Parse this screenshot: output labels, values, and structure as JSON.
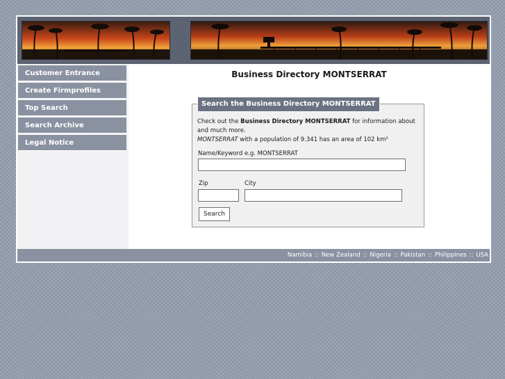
{
  "nav": {
    "items": [
      {
        "label": "Customer Entrance"
      },
      {
        "label": "Create Firmprofiles"
      },
      {
        "label": "Top Search"
      },
      {
        "label": "Search Archive"
      },
      {
        "label": "Legal Notice"
      }
    ]
  },
  "main": {
    "title": "Business Directory MONTSERRAT",
    "search_box": {
      "legend": "Search the Business Directory MONTSERRAT",
      "desc_prefix": "Check out the ",
      "desc_bold": "Business Directory MONTSERRAT",
      "desc_suffix": " for information about and much more.",
      "pop_italic": "MONTSERRAT",
      "pop_text": " with a population of 9.341 has an area of 102 km²",
      "keyword_label": "Name/Keyword e.g. MONTSERRAT",
      "keyword_value": "",
      "zip_label": "Zip",
      "zip_value": "",
      "city_label": "City",
      "city_value": "",
      "search_button": "Search"
    }
  },
  "footer": {
    "links": [
      "Namibia",
      "New Zealand",
      "Nigeria",
      "Pakistan",
      "Philippines",
      "USA"
    ],
    "separator": "::"
  }
}
